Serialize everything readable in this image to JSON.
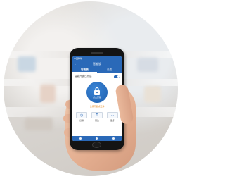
{
  "app": {
    "title": "智能锁",
    "status_text": "中国移动",
    "back_icon": "back-arrow-icon"
  },
  "tabs": [
    {
      "label": "智能锁",
      "active": true
    },
    {
      "label": "设置",
      "active": false
    }
  ],
  "settings_row": {
    "label": "智能开锁已开启",
    "toggle_on": true
  },
  "lock": {
    "icon": "lock-icon",
    "label": "点击开锁",
    "hint": "长按开锁或更多"
  },
  "actions": [
    {
      "icon": "clock-icon",
      "glyph": "◷",
      "label": "记录"
    },
    {
      "icon": "key-icon",
      "glyph": "⚿",
      "label": "钥匙"
    },
    {
      "icon": "more-icon",
      "glyph": "⋯",
      "label": "更多"
    }
  ],
  "colors": {
    "accent": "#2a69b8",
    "hint": "#e8902b"
  }
}
